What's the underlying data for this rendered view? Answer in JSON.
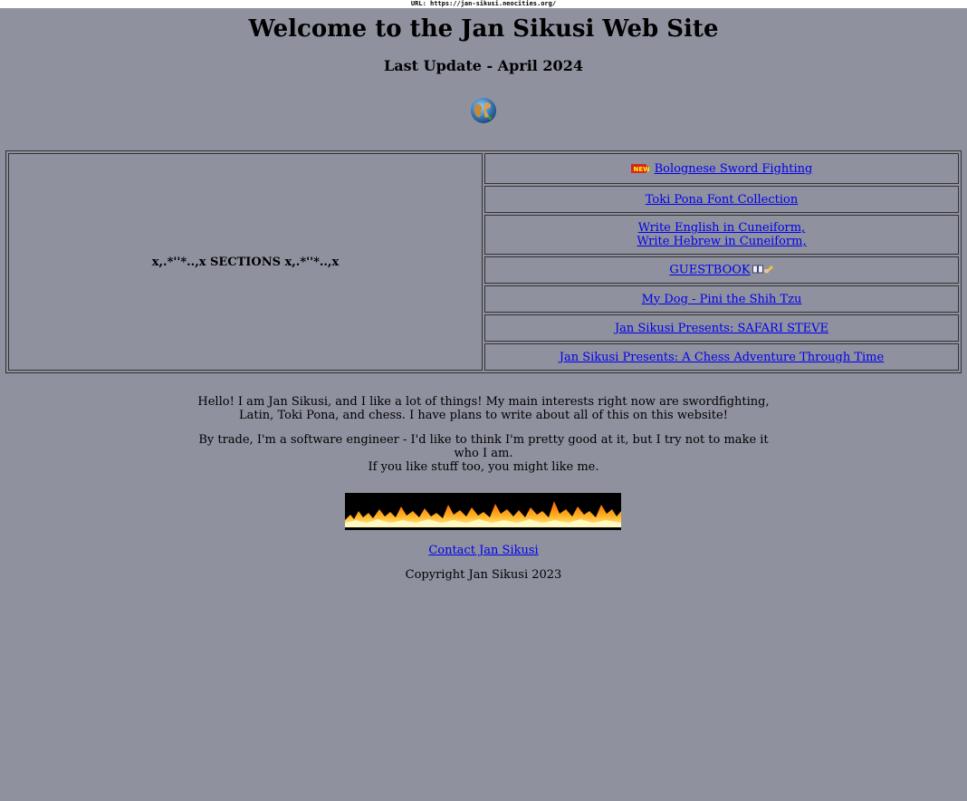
{
  "url_bar": {
    "text": "URL: https://jan-sikusi.neocities.org/"
  },
  "header": {
    "title": "Welcome to the Jan Sikusi Web Site",
    "subtitle": "Last Update - April 2024",
    "globe_icon": "globe-icon"
  },
  "sections": {
    "heading": "x,.*''*..,x SECTIONS x,.*''*..,x",
    "links": [
      {
        "label": "Bolognese Sword Fighting",
        "badge": "NEW"
      },
      {
        "label": "Toki Pona Font Collection"
      },
      {
        "label": "Write English in Cuneiform,",
        "label2": "Write Hebrew in Cuneiform,"
      },
      {
        "label": "GUESTBOOK",
        "icons": [
          "book-icon",
          "writing-hand-icon"
        ]
      },
      {
        "label": "My Dog - Pini the Shih Tzu"
      },
      {
        "label": "Jan Sikusi Presents: SAFARI STEVE"
      },
      {
        "label": "Jan Sikusi Presents: A Chess Adventure Through Time"
      }
    ]
  },
  "intro": {
    "p1": "Hello! I am Jan Sikusi, and I like a lot of things! My main interests right now are swordfighting, Latin, Toki Pona, and chess. I have plans to write about all of this on this website!",
    "p2_line1": "By trade, I'm a software engineer - I'd like to think I'm pretty good at it, but I try not to make it who I am.",
    "p2_line2": "If you like stuff too, you might like me."
  },
  "footer": {
    "contact_label": "Contact Jan Sikusi",
    "copyright": "Copyright Jan Sikusi 2023"
  },
  "colors": {
    "background": "#8f919f",
    "link": "#0000ee",
    "text": "#000000"
  }
}
